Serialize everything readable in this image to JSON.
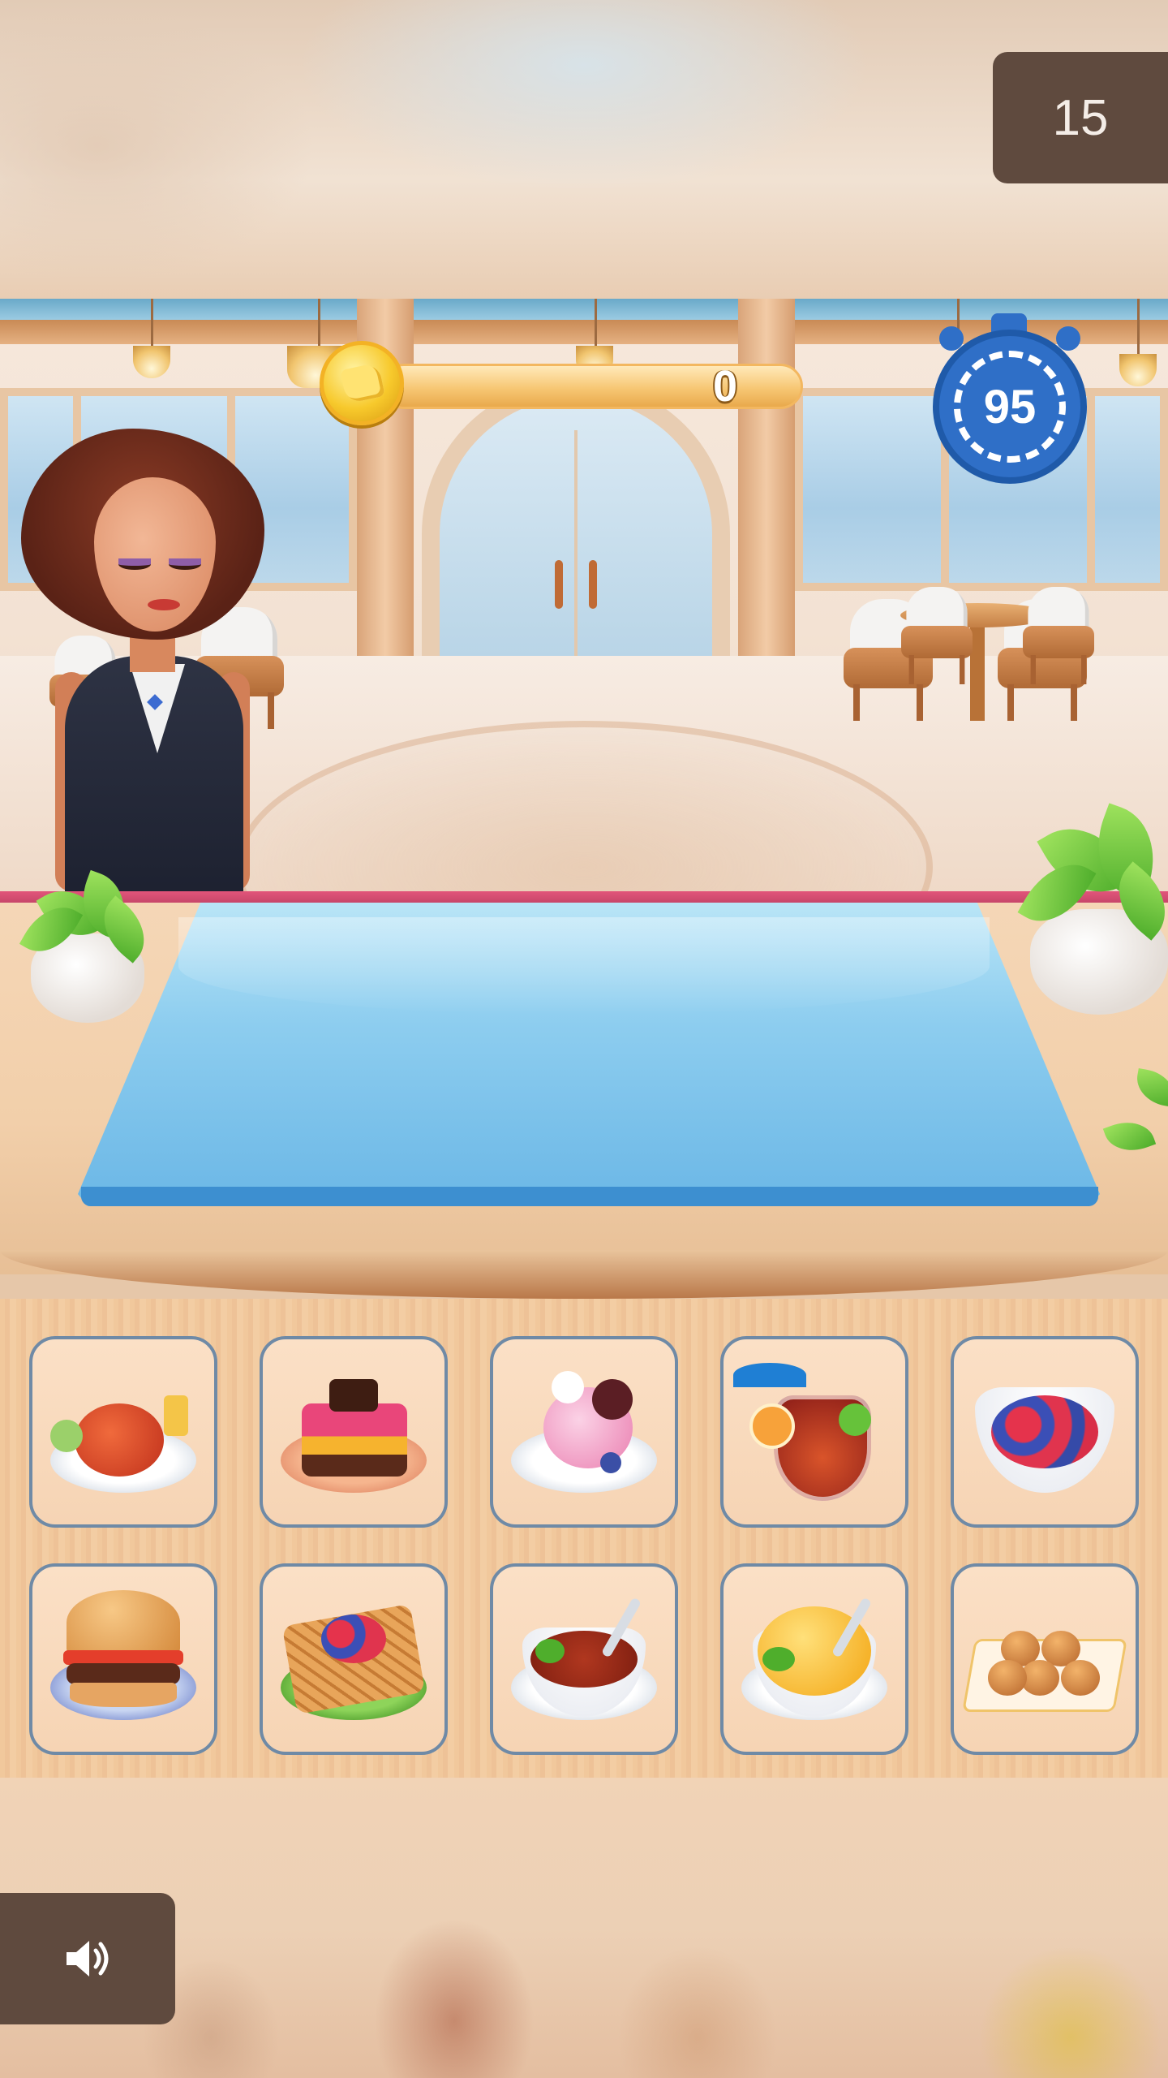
{
  "hud": {
    "moves_counter": "15",
    "coins": "0",
    "timer": "95"
  },
  "icons": {
    "coin": "coin-icon",
    "timer": "stopwatch-icon",
    "sound": "speaker-icon"
  },
  "food_items": [
    {
      "name": "lobster-platter"
    },
    {
      "name": "chocolate-cake-slice"
    },
    {
      "name": "ice-cream-sundae"
    },
    {
      "name": "fruit-punch-drink"
    },
    {
      "name": "berry-bowl"
    },
    {
      "name": "burger"
    },
    {
      "name": "berry-waffle"
    },
    {
      "name": "tomato-soup"
    },
    {
      "name": "mango-pudding"
    },
    {
      "name": "glazed-buns"
    }
  ],
  "colors": {
    "hud_box": "#5f4a3e",
    "tile_border": "#6f8aa6",
    "tray": "#8dcdef",
    "timer": "#2f6fc7"
  }
}
